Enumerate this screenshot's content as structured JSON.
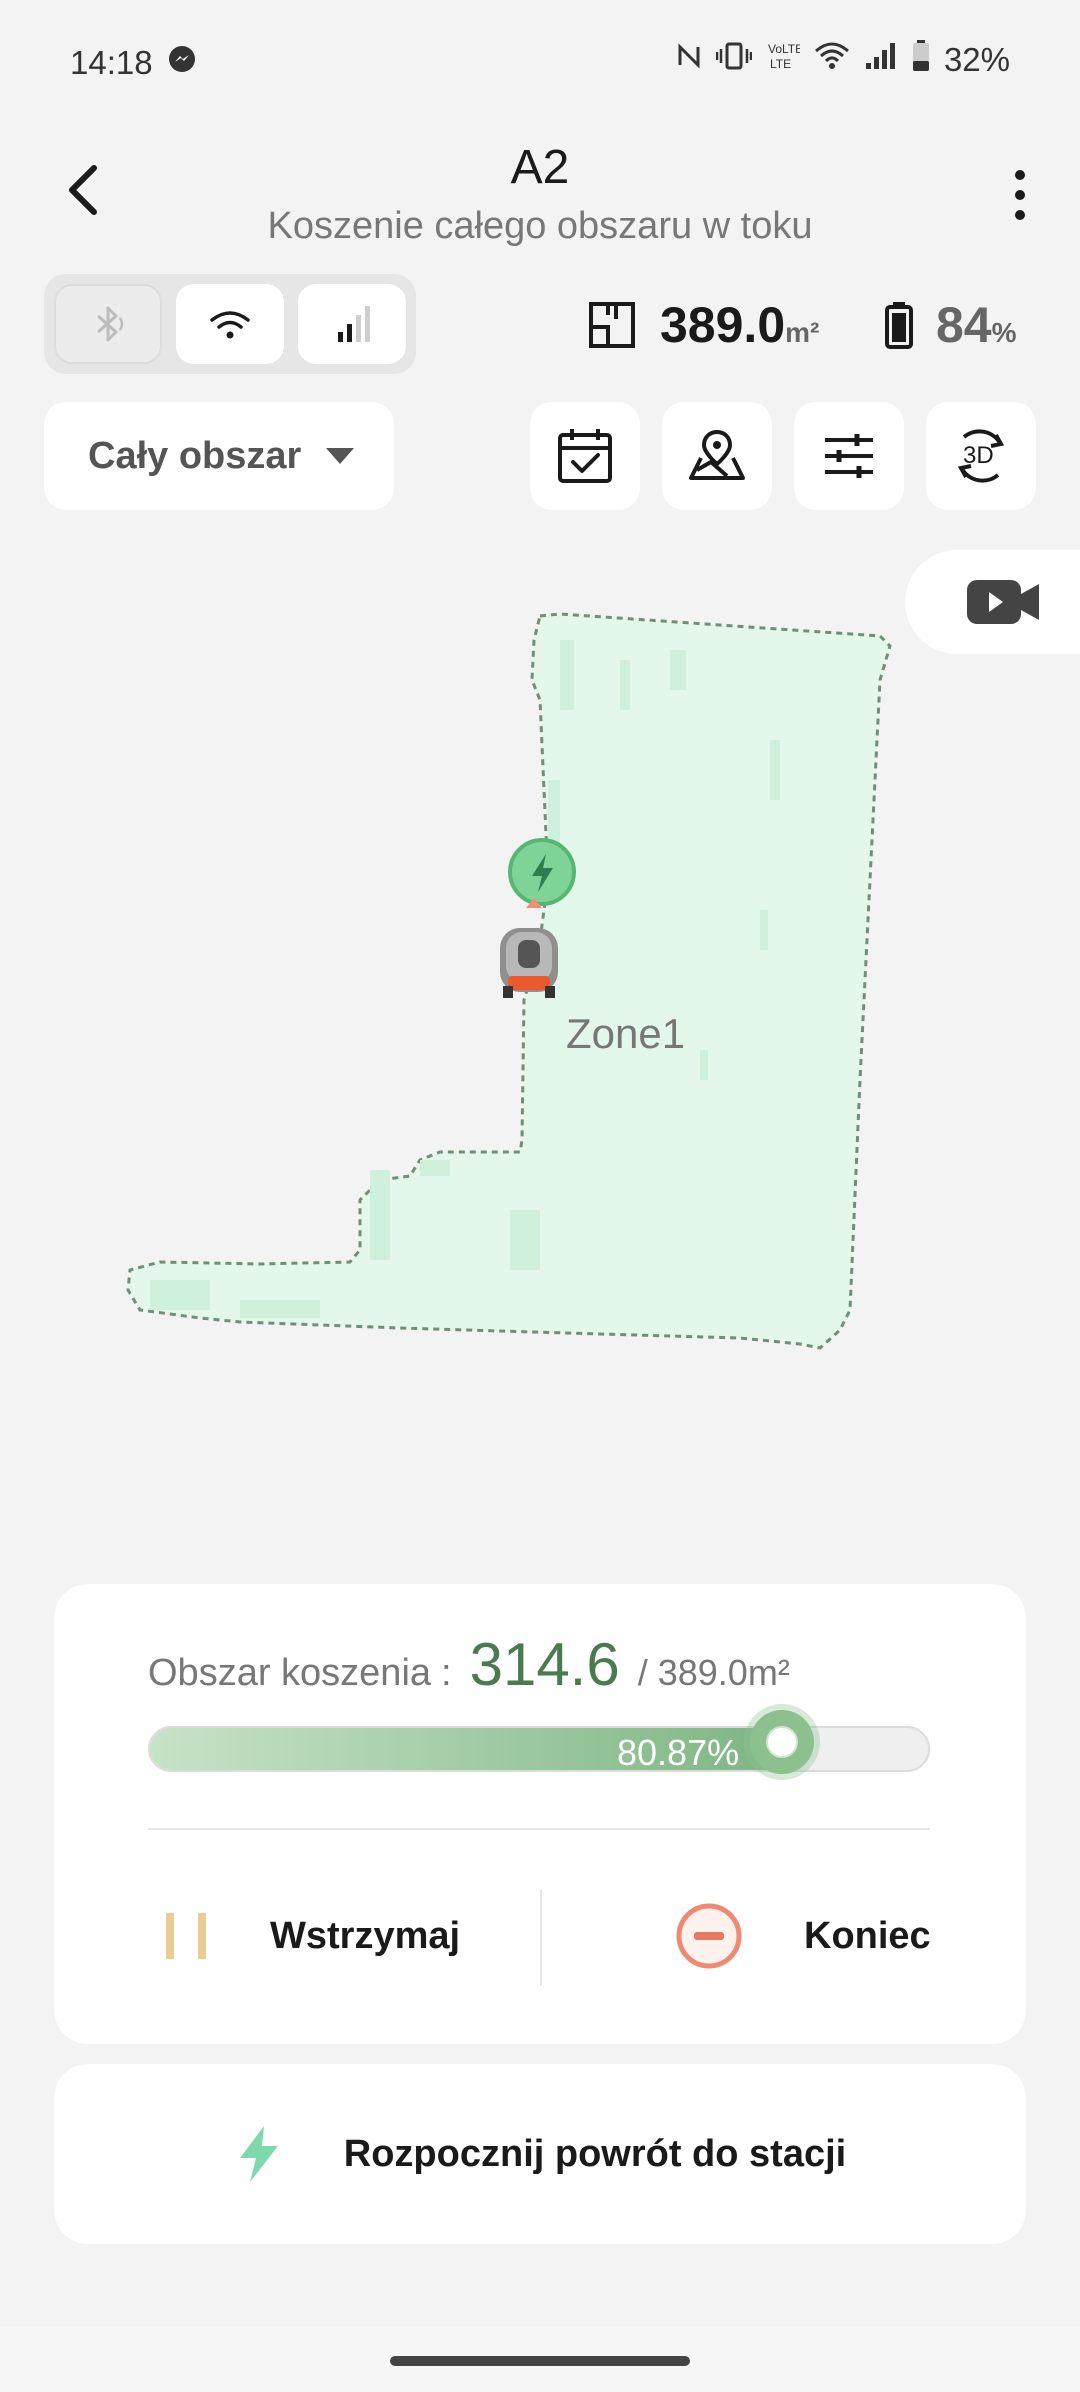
{
  "status_bar": {
    "time": "14:18",
    "battery_pct": "32%",
    "icons": [
      "messenger-icon",
      "nfc-icon",
      "vibrate-icon",
      "volte-icon",
      "wifi-icon",
      "signal-icon",
      "battery-icon"
    ]
  },
  "header": {
    "title": "A2",
    "subtitle": "Koszenie całego obszaru w toku"
  },
  "connectivity": {
    "bluetooth": "inactive",
    "wifi": "active",
    "cellular": "active"
  },
  "stats": {
    "area_value": "389.0",
    "area_unit": "m²",
    "battery_value": "84",
    "battery_unit": "%"
  },
  "area_select": {
    "selected": "Cały obszar"
  },
  "map": {
    "zone_label": "Zone1"
  },
  "progress": {
    "label": "Obszar koszenia",
    "separator": ":",
    "done": "314.6",
    "total": "/ 389.0m²",
    "percent_text": "80.87%",
    "fraction": 0.8087
  },
  "actions": {
    "pause_label": "Wstrzymaj",
    "end_label": "Koniec",
    "return_label": "Rozpocznij powrót do stacji"
  },
  "colors": {
    "accent_green": "#4a7a4f",
    "map_fill": "#e3f7ea",
    "end_red": "#e8785e",
    "pause_gold": "#e2c48a"
  }
}
